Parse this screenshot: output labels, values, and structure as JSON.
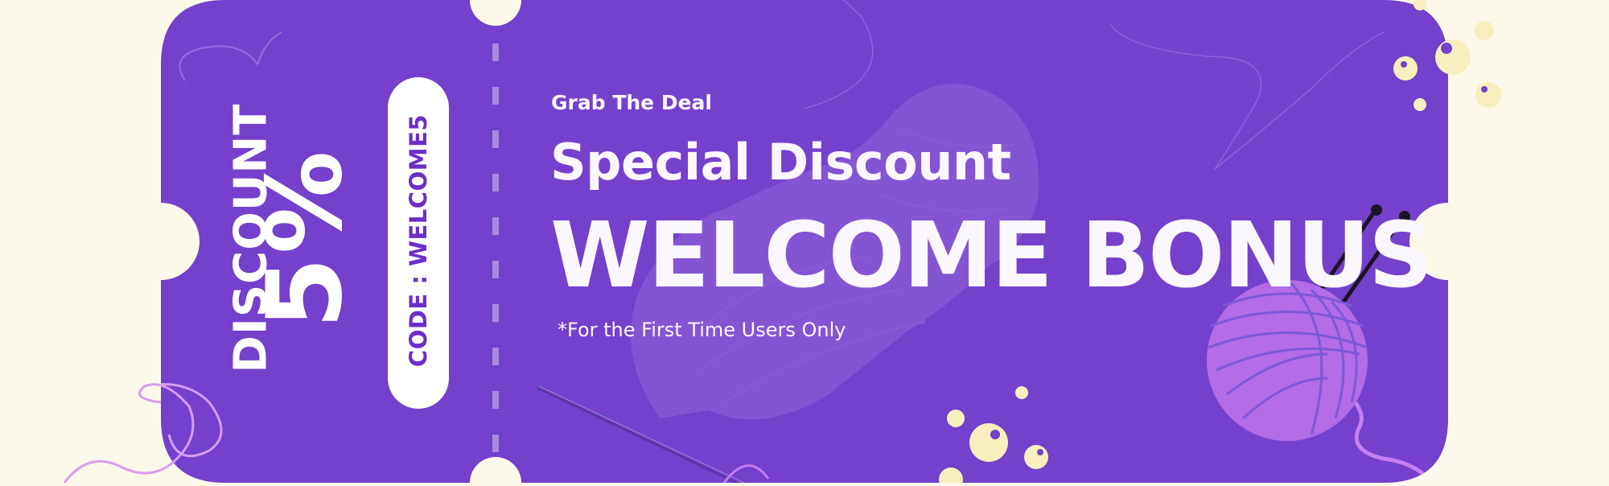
{
  "coupon": {
    "tagline": "Grab The Deal",
    "headline": "Special Discount",
    "title": "WELCOME BONUS",
    "footnote": "*For the First Time Users Only",
    "discount_label": "DISCOUNT",
    "discount_value": "5%",
    "code_text": "CODE : WELCOME5"
  },
  "colors": {
    "page_background": "#fdf9ea",
    "ticket": "#7440cc",
    "accent_dots": "#f8efbe",
    "yarn": "#b36be6",
    "text": "#ffffff",
    "code_text": "#6b2fc8"
  },
  "icons": {
    "yarn_ball": "yarn-ball-icon",
    "knitting_needles": "knitting-needles-icon",
    "sewing_needle": "sewing-needle-icon",
    "decorative_thread": "thread-icon",
    "ghost_yarn": "yarn-ghost-icon"
  }
}
